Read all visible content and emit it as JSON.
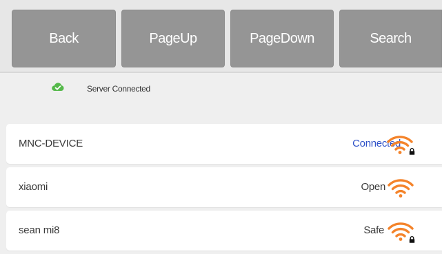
{
  "toolbar": {
    "back_label": "Back",
    "pageup_label": "PageUp",
    "pagedown_label": "PageDown",
    "search_label": "Search"
  },
  "status": {
    "text": "Server Connected",
    "icon": "cloud-check-icon",
    "icon_color": "#55b94a"
  },
  "colors": {
    "button_bg": "#959595",
    "wifi_signal": "#f4832a",
    "connected_text": "#2f52c8"
  },
  "networks": [
    {
      "name": "MNC-DEVICE",
      "status": "Connected",
      "secured": true
    },
    {
      "name": "xiaomi",
      "status": "Open",
      "secured": false
    },
    {
      "name": "sean mi8",
      "status": "Safe",
      "secured": true
    }
  ]
}
